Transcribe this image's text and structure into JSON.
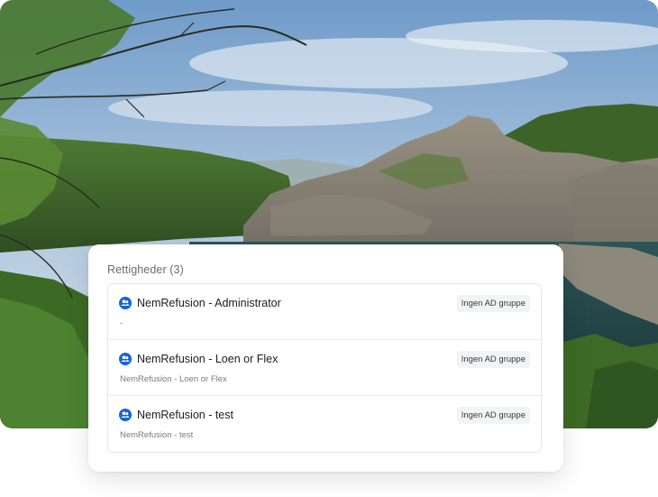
{
  "colors": {
    "accent": "#1565d8",
    "card_background": "#ffffff",
    "badge_background": "#f2f3f5",
    "border": "#e3e5e8"
  },
  "background": {
    "icon": "landscape-photo"
  },
  "panel": {
    "title": "Rettigheder (3)",
    "rows": [
      {
        "icon": "group-icon",
        "name": "NemRefusion - Administrator",
        "description": "-",
        "badge": "Ingen AD gruppe"
      },
      {
        "icon": "group-icon",
        "name": "NemRefusion - Loen or Flex",
        "description": "NemRefusion - Loen or Flex",
        "badge": "Ingen AD gruppe"
      },
      {
        "icon": "group-icon",
        "name": "NemRefusion - test",
        "description": "NemRefusion - test",
        "badge": "Ingen AD gruppe"
      }
    ]
  }
}
